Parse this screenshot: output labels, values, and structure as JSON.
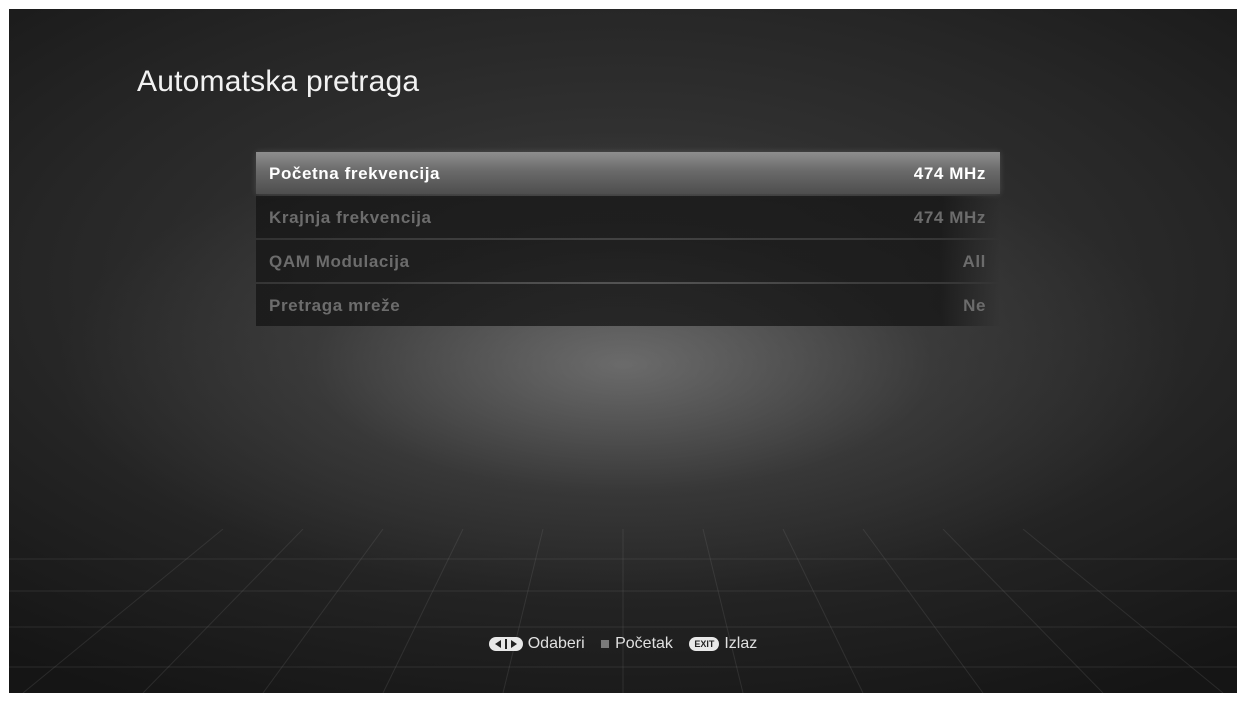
{
  "screen": {
    "title": "Automatska pretraga"
  },
  "menu": {
    "items": [
      {
        "label": "Početna frekvencija",
        "value": "474 MHz",
        "selected": true
      },
      {
        "label": "Krajnja frekvencija",
        "value": "474 MHz",
        "selected": false
      },
      {
        "label": "QAM Modulacija",
        "value": "All",
        "selected": false
      },
      {
        "label": "Pretraga mreže",
        "value": "Ne",
        "selected": false
      }
    ]
  },
  "footer": {
    "select_label": "Odaberi",
    "start_label": "Početak",
    "exit_label": "Izlaz",
    "exit_icon_text": "EXIT"
  },
  "colors": {
    "selected_row": "#7a7a7a",
    "inactive_text": "#6c6c6c",
    "active_text": "#ffffff"
  }
}
